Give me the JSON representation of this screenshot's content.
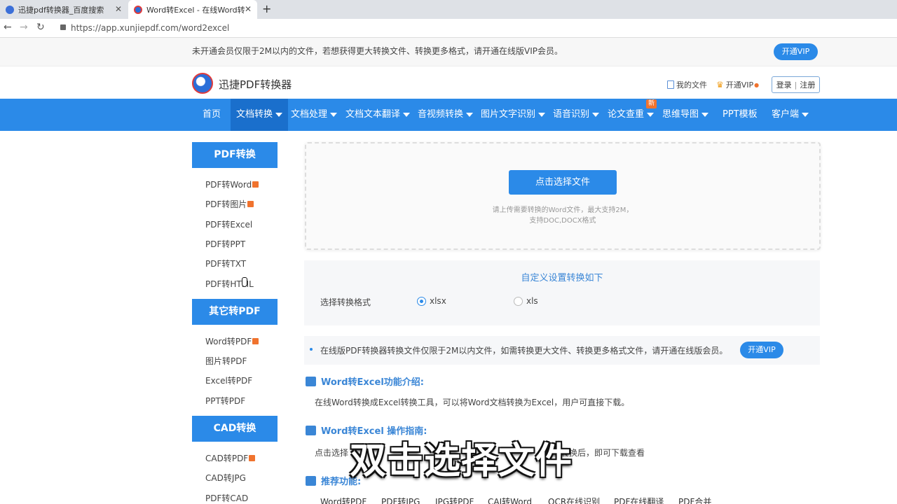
{
  "browser": {
    "tabs": [
      {
        "title": "迅捷pdf转换器_百度搜索",
        "icon": "baidu-paw-icon",
        "active": false
      },
      {
        "title": "Word转Excel - 在线Word转化E",
        "icon": "xunjie-logo-icon",
        "active": true
      }
    ],
    "url": "https://app.xunjiepdf.com/word2excel"
  },
  "notice": {
    "text": "未开通会员仅限于2M以内的文件，若想获得更大转换文件、转换更多格式，请开通在线版VIP会员。",
    "vip_button": "开通VIP"
  },
  "header": {
    "brand": "迅捷PDF转换器",
    "my_files": "我的文件",
    "vip": "开通VIP",
    "login": "登录",
    "separator": "|",
    "register": "注册"
  },
  "nav": {
    "items": [
      "首页",
      "文档转换",
      "文档处理",
      "文档文本翻译",
      "音视频转换",
      "图片文字识别",
      "语音识别",
      "论文查重",
      "思维导图",
      "PPT模板",
      "客户端"
    ],
    "badge": "新"
  },
  "sidebar": {
    "sections": [
      {
        "title": "PDF转换",
        "items": [
          "PDF转Word",
          "PDF转图片",
          "PDF转Excel",
          "PDF转PPT",
          "PDF转TXT",
          "PDF转HTML"
        ]
      },
      {
        "title": "其它转PDF",
        "items": [
          "Word转PDF",
          "图片转PDF",
          "Excel转PDF",
          "PPT转PDF"
        ]
      },
      {
        "title": "CAD转换",
        "items": [
          "CAD转PDF",
          "CAD转JPG",
          "PDF转CAD"
        ]
      }
    ]
  },
  "upload": {
    "button": "点击选择文件",
    "hint_line1": "请上传需要转换的Word文件，最大支持2M，",
    "hint_line2": "支持DOC,DOCX格式"
  },
  "settings": {
    "title": "自定义设置转换如下",
    "format_label": "选择转换格式",
    "options": [
      "xlsx",
      "xls"
    ],
    "selected": "xlsx"
  },
  "info": {
    "text": "在线版PDF转换器转换文件仅限于2M以内文件，如需转换更大文件、转换更多格式文件，请开通在线版会员。",
    "vip_button": "开通VIP"
  },
  "intro": {
    "title": "Word转Excel功能介绍:",
    "text": "在线Word转换成Excel转换工具，可以将Word文档转换为Excel，用户可直接下载。"
  },
  "guide": {
    "title": "Word转Excel 操作指南:",
    "text_start": "点击选择",
    "text_end": "转换后，即可下载查看"
  },
  "recommend": {
    "title": "推荐功能:",
    "items": [
      "Word转PDF",
      "PDF转JPG",
      "JPG转PDF",
      "CAJ转Word",
      "OCR在线识别",
      "PDF在线翻译",
      "PDF合并"
    ]
  },
  "caption": "双击选择文件",
  "colors": {
    "primary": "#2b8ae8",
    "nav_active": "#1a6fcc",
    "accent": "#f0732e"
  }
}
